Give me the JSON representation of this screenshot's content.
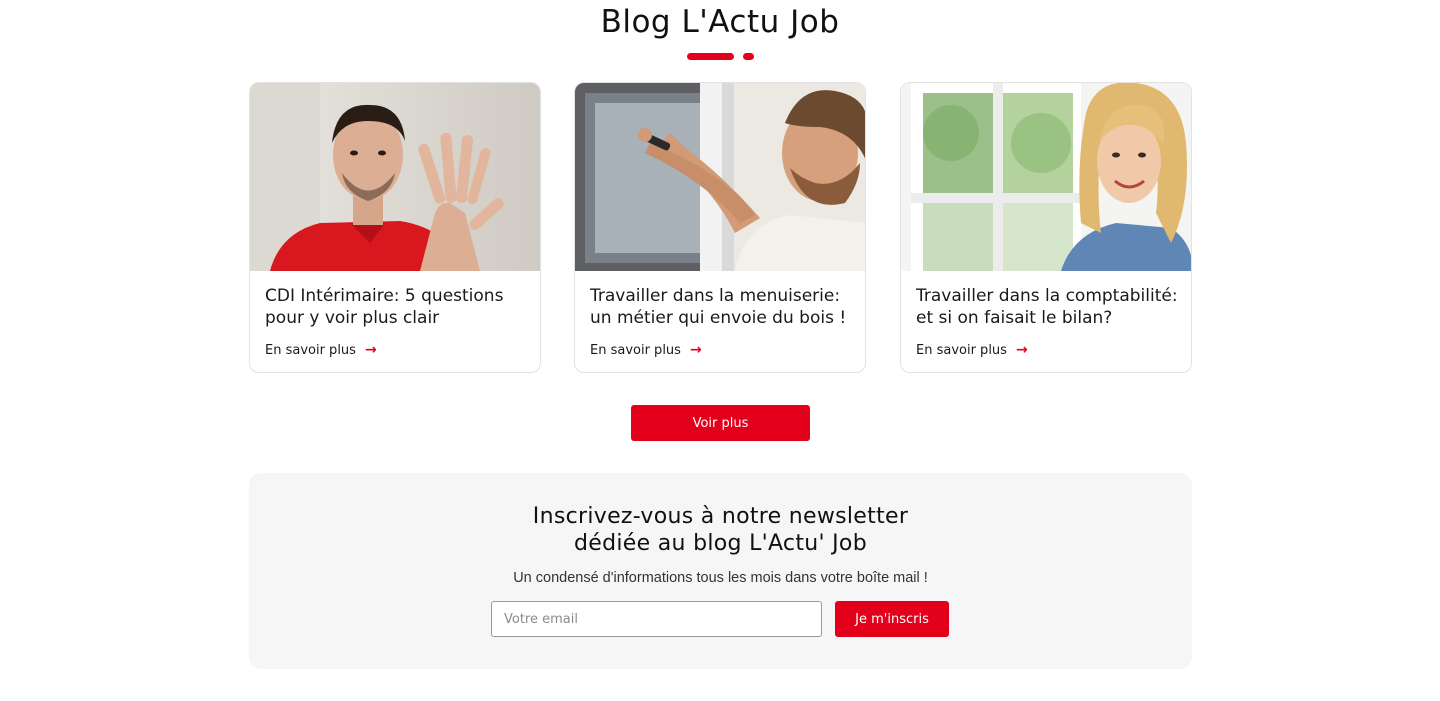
{
  "blog": {
    "title": "Blog L'Actu Job",
    "accent_color": "#e3001b"
  },
  "articles": [
    {
      "title": "CDI Intérimaire: 5 questions pour y voir plus clair",
      "link_label": "En savoir plus",
      "image": "man-red-polo-showing-five-fingers"
    },
    {
      "title": "Travailler dans la menuiserie: un métier qui envoie du bois !",
      "link_label": "En savoir plus",
      "image": "carpenter-fixing-window"
    },
    {
      "title": "Travailler dans la comptabilité: et si on faisait le bilan?",
      "link_label": "En savoir plus",
      "image": "smiling-woman-by-window"
    }
  ],
  "more_button": {
    "label": "Voir plus"
  },
  "newsletter": {
    "title_line1": "Inscrivez-vous à notre newsletter",
    "title_line2": "dédiée au blog L'Actu' Job",
    "subtitle": "Un condensé d'informations tous les mois dans votre boîte mail !",
    "email_placeholder": "Votre email",
    "email_value": "",
    "submit_label": "Je m'inscris"
  }
}
